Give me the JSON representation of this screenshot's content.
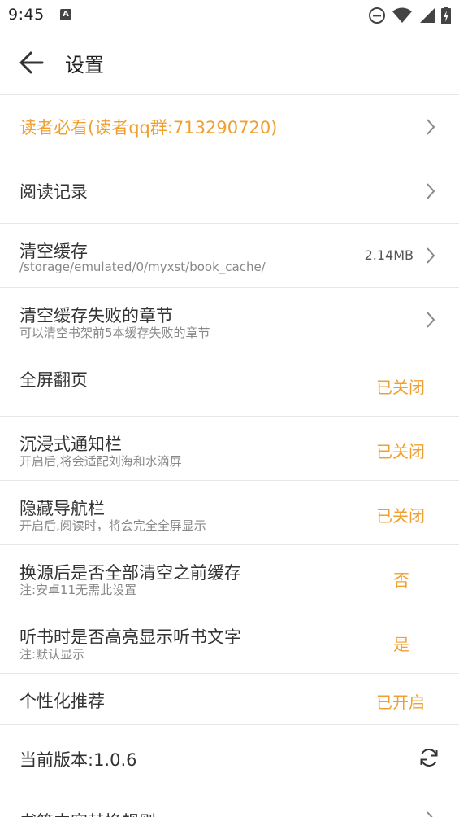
{
  "status_bar": {
    "time": "9:45",
    "app_icon": "A"
  },
  "header": {
    "title": "设置"
  },
  "colors": {
    "accent": "#f0a030",
    "text": "#333333",
    "subtext": "#888888",
    "divider": "#e6e6e6"
  },
  "rows": [
    {
      "title": "读者必看(读者qq群:713290720)",
      "chevron": true
    },
    {
      "title": "阅读记录",
      "chevron": true
    },
    {
      "title": "清空缓存",
      "sub": "/storage/emulated/0/myxst/book_cache/",
      "size": "2.14MB",
      "chevron": true
    },
    {
      "title": "清空缓存失败的章节",
      "sub": "可以清空书架前5本缓存失败的章节",
      "chevron": true
    },
    {
      "title": "全屏翻页",
      "value": "已关闭"
    },
    {
      "title": "沉浸式通知栏",
      "sub": "开启后,将会适配刘海和水滴屏",
      "value": "已关闭"
    },
    {
      "title": "隐藏导航栏",
      "sub": "开启后,阅读时，将会完全全屏显示",
      "value": "已关闭"
    },
    {
      "title": "换源后是否全部清空之前缓存",
      "sub": "注:安卓11无需此设置",
      "value": "否"
    },
    {
      "title": "听书时是否高亮显示听书文字",
      "sub": "注:默认显示",
      "value": "是"
    },
    {
      "title": "个性化推荐",
      "value": "已开启"
    },
    {
      "title": "当前版本:1.0.6"
    },
    {
      "title": "书籍内容替换规则",
      "chevron": true
    }
  ]
}
